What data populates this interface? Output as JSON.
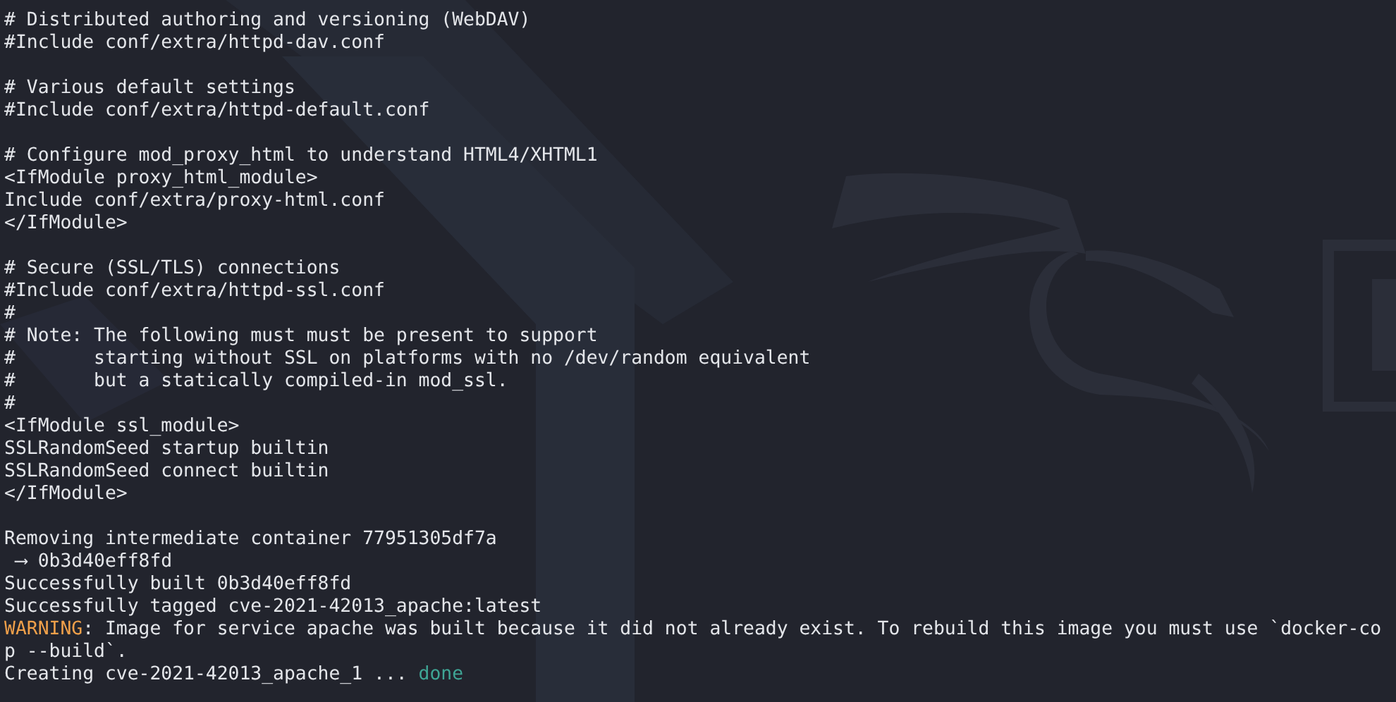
{
  "terminal": {
    "lines": [
      {
        "kind": "text",
        "text": "# Distributed authoring and versioning (WebDAV)"
      },
      {
        "kind": "text",
        "text": "#Include conf/extra/httpd-dav.conf"
      },
      {
        "kind": "blank"
      },
      {
        "kind": "text",
        "text": "# Various default settings"
      },
      {
        "kind": "text",
        "text": "#Include conf/extra/httpd-default.conf"
      },
      {
        "kind": "blank"
      },
      {
        "kind": "text",
        "text": "# Configure mod_proxy_html to understand HTML4/XHTML1"
      },
      {
        "kind": "text",
        "text": "<IfModule proxy_html_module>"
      },
      {
        "kind": "text",
        "text": "Include conf/extra/proxy-html.conf"
      },
      {
        "kind": "text",
        "text": "</IfModule>"
      },
      {
        "kind": "blank"
      },
      {
        "kind": "text",
        "text": "# Secure (SSL/TLS) connections"
      },
      {
        "kind": "text",
        "text": "#Include conf/extra/httpd-ssl.conf"
      },
      {
        "kind": "text",
        "text": "#"
      },
      {
        "kind": "text",
        "text": "# Note: The following must must be present to support"
      },
      {
        "kind": "text",
        "text": "#       starting without SSL on platforms with no /dev/random equivalent"
      },
      {
        "kind": "text",
        "text": "#       but a statically compiled-in mod_ssl."
      },
      {
        "kind": "text",
        "text": "#"
      },
      {
        "kind": "text",
        "text": "<IfModule ssl_module>"
      },
      {
        "kind": "text",
        "text": "SSLRandomSeed startup builtin"
      },
      {
        "kind": "text",
        "text": "SSLRandomSeed connect builtin"
      },
      {
        "kind": "text",
        "text": "</IfModule>"
      },
      {
        "kind": "blank"
      },
      {
        "kind": "text",
        "text": "Removing intermediate container 77951305df7a"
      },
      {
        "kind": "text",
        "text": " ⟶ 0b3d40eff8fd"
      },
      {
        "kind": "text",
        "text": "Successfully built 0b3d40eff8fd"
      },
      {
        "kind": "text",
        "text": "Successfully tagged cve-2021-42013_apache:latest"
      },
      {
        "kind": "warning",
        "label": "WARNING",
        "text": ": Image for service apache was built because it did not already exist. To rebuild this image you must use `docker-co"
      },
      {
        "kind": "text",
        "text": "p --build`."
      },
      {
        "kind": "status",
        "text": "Creating cve-2021-42013_apache_1 ... ",
        "status": "done"
      }
    ]
  }
}
